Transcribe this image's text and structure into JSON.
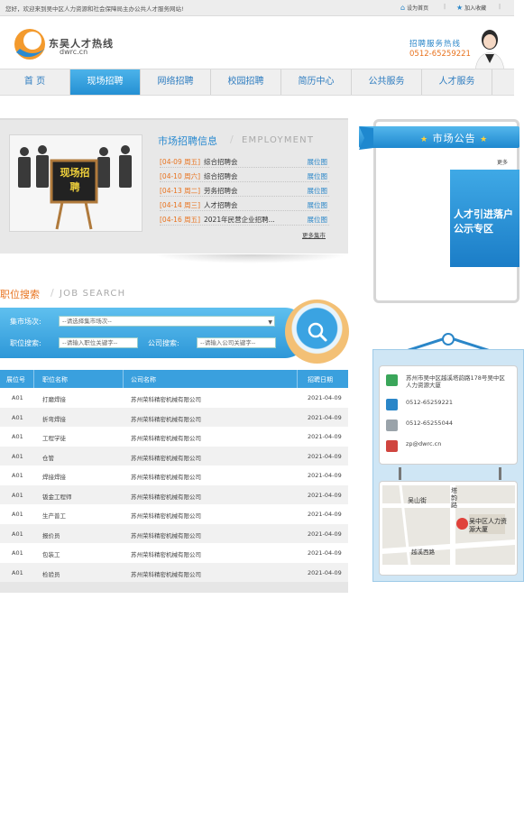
{
  "topbar": {
    "welcome": "您好，欢迎来到吴中区人力资源和社会保障局主办公共人才服务网站!",
    "home_link": "设为首页",
    "fav_link": "加入收藏",
    "separator": "|"
  },
  "header": {
    "logo_text": "东吴人才热线",
    "logo_domain": "dwrc.cn",
    "hotline_title": "招聘服务热线",
    "hotline_number": "0512-65259221"
  },
  "nav": [
    "首 页",
    "现场招聘",
    "网络招聘",
    "校园招聘",
    "简历中心",
    "公共服务",
    "人才服务"
  ],
  "employment": {
    "title": "市场招聘信息",
    "subtitle": "EMPLOYMENT",
    "photo_sign": "现场招聘",
    "items": [
      {
        "date": "[04-09 周五]",
        "name": "综合招聘会",
        "link": "展位图"
      },
      {
        "date": "[04-10 周六]",
        "name": "综合招聘会",
        "link": "展位图"
      },
      {
        "date": "[04-13 周二]",
        "name": "劳务招聘会",
        "link": "展位图"
      },
      {
        "date": "[04-14 周三]",
        "name": "人才招聘会",
        "link": "展位图"
      },
      {
        "date": "[04-16 周五]",
        "name": "2021年民营企业招聘...",
        "link": "展位图"
      }
    ],
    "more": "更多集市"
  },
  "jobsearch": {
    "title": "职位搜索",
    "subtitle": "JOB SEARCH",
    "market_label": "集市场次:",
    "market_placeholder": "--请选择集市场次--",
    "job_label": "职位搜索:",
    "job_placeholder": "--请输入职位关键字--",
    "company_label": "公司搜索:",
    "company_placeholder": "--请输入公司关键字--"
  },
  "table": {
    "headers": [
      "展位号",
      "职位名称",
      "公司名称",
      "招聘日期"
    ],
    "rows": [
      [
        "A01",
        "打磨焊接",
        "苏州荣科精密机械有限公司",
        "2021-04-09"
      ],
      [
        "A01",
        "折弯焊接",
        "苏州荣科精密机械有限公司",
        "2021-04-09"
      ],
      [
        "A01",
        "工程学徒",
        "苏州荣科精密机械有限公司",
        "2021-04-09"
      ],
      [
        "A01",
        "仓管",
        "苏州荣科精密机械有限公司",
        "2021-04-09"
      ],
      [
        "A01",
        "焊接焊接",
        "苏州荣科精密机械有限公司",
        "2021-04-09"
      ],
      [
        "A01",
        "钣金工程师",
        "苏州荣科精密机械有限公司",
        "2021-04-09"
      ],
      [
        "A01",
        "生产普工",
        "苏州荣科精密机械有限公司",
        "2021-04-09"
      ],
      [
        "A01",
        "报价员",
        "苏州荣科精密机械有限公司",
        "2021-04-09"
      ],
      [
        "A01",
        "包装工",
        "苏州荣科精密机械有限公司",
        "2021-04-09"
      ],
      [
        "A01",
        "检验员",
        "苏州荣科精密机械有限公司",
        "2021-04-09"
      ]
    ]
  },
  "notice": {
    "title": "市场公告",
    "more": "更多",
    "banner": "人才引进落户公示专区"
  },
  "contact": {
    "address": "苏州市吴中区越溪塔韵路178号吴中区人力资源大厦",
    "phone1": "0512-65259221",
    "phone2": "0512-65255044",
    "email": "zp@dwrc.cn"
  },
  "map": {
    "road1": "吴山街",
    "road2": "塔韵路",
    "road3": "越溪西路",
    "poi": "吴中区人力资源大厦"
  },
  "colors": {
    "accent": "#2a8ad0",
    "orange": "#e8731f",
    "nav_active": "#2590d3"
  }
}
